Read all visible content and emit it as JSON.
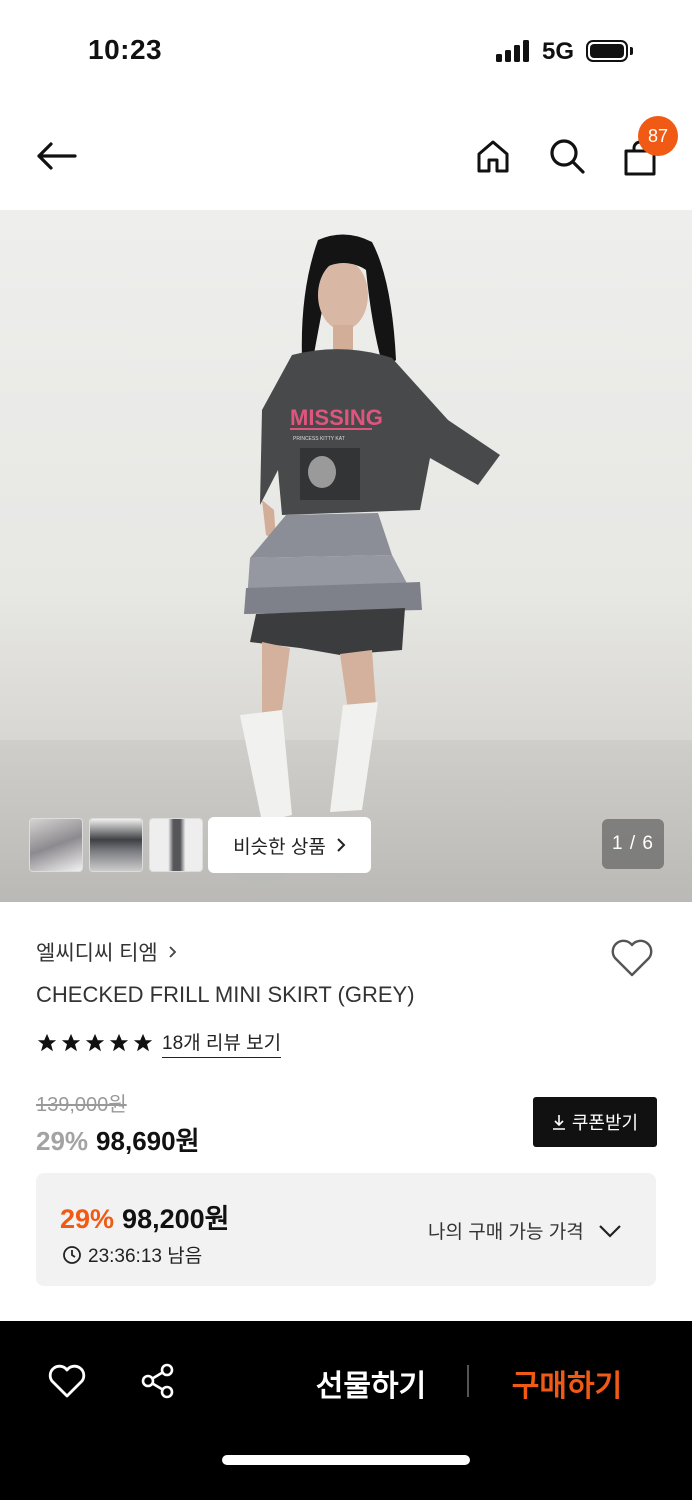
{
  "status_bar": {
    "time": "10:23",
    "network": "5G"
  },
  "nav": {
    "back_icon": "arrow-left-icon",
    "home_icon": "home-icon",
    "search_icon": "search-icon",
    "cart_icon": "shopping-bag-icon",
    "cart_count": "87"
  },
  "gallery": {
    "similar_label": "비슷한 상품",
    "page_indicator": "1 / 6",
    "current_page": 1,
    "total_pages": 6,
    "thumbnail_count": 3
  },
  "product": {
    "brand": "엘씨디씨 티엠",
    "name": "CHECKED FRILL MINI SKIRT (GREY)",
    "rating_stars": 5,
    "review_link": "18개 리뷰 보기",
    "original_price": "139,000원",
    "discount_pct": "29%",
    "sale_price": "98,690원",
    "coupon_label": "쿠폰받기"
  },
  "my_price": {
    "discount_pct": "29%",
    "price": "98,200원",
    "timer": "23:36:13 남음",
    "label": "나의 구매 가능 가격"
  },
  "bottom_bar": {
    "gift_label": "선물하기",
    "buy_label": "구매하기"
  },
  "colors": {
    "accent": "#f05a14",
    "dark": "#111111",
    "panel": "#f2f2f2"
  }
}
